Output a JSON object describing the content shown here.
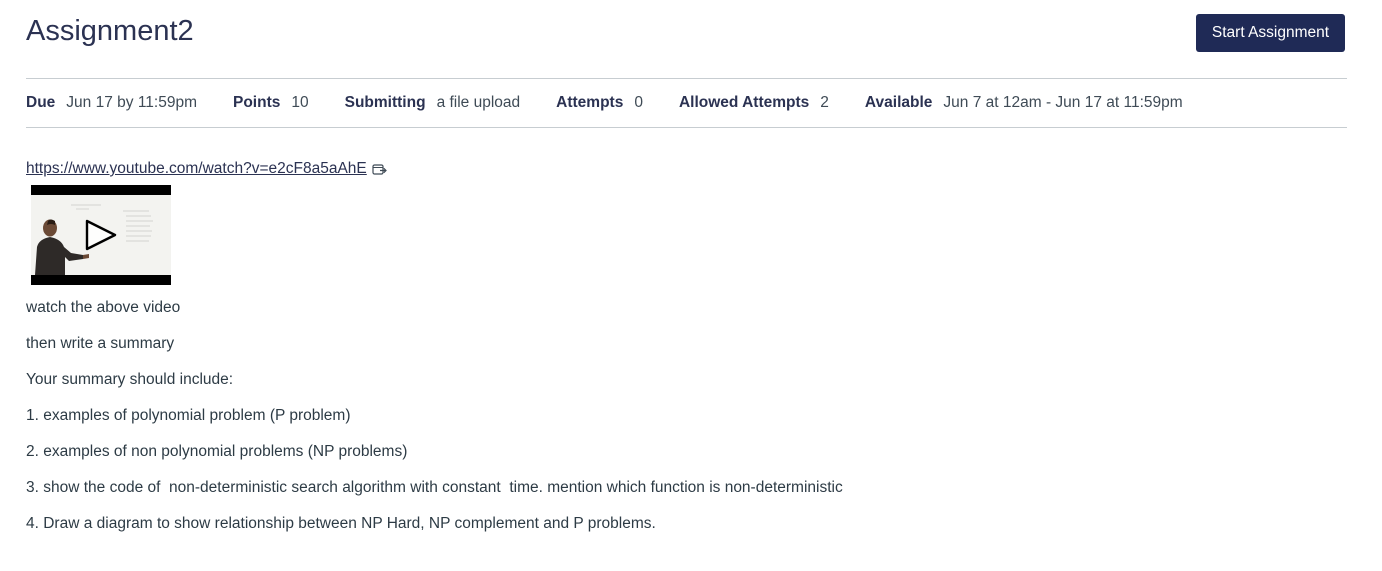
{
  "assignment": {
    "title": "Assignment2",
    "start_button_label": "Start Assignment"
  },
  "details": [
    {
      "label": "Due",
      "value": "Jun 17 by 11:59pm"
    },
    {
      "label": "Points",
      "value": "10"
    },
    {
      "label": "Submitting",
      "value": "a file upload"
    },
    {
      "label": "Attempts",
      "value": "0"
    },
    {
      "label": "Allowed Attempts",
      "value": "2"
    },
    {
      "label": "Available",
      "value": "Jun 7 at 12am - Jun 17 at 11:59pm"
    }
  ],
  "description": {
    "video_link": "https://www.youtube.com/watch?v=e2cF8a5aAhE",
    "external_link_icon": "external-link-icon",
    "video_thumbnail_icon": "play-icon",
    "paragraphs": [
      "watch the above video",
      "then write a summary",
      "Your summary should include:",
      "1. examples of polynomial problem (P problem)",
      "2. examples of non polynomial problems (NP problems)",
      "3. show the code of  non-deterministic search algorithm with constant  time. mention which function is non-deterministic",
      "4. Draw a diagram to show relationship between NP Hard, NP complement and P problems."
    ]
  },
  "colors": {
    "heading": "#2b3252",
    "button_bg": "#1f2a56",
    "text": "#2d3b45",
    "divider": "#c7cdd1"
  }
}
